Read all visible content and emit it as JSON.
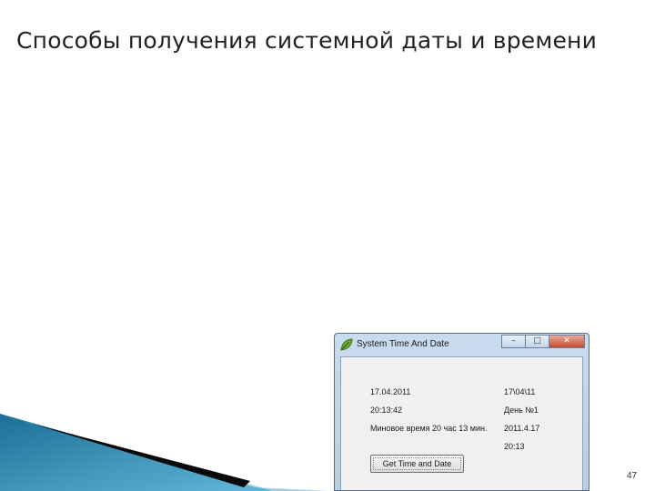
{
  "slide": {
    "title": "Способы получения системной даты и времени",
    "page_number": "47"
  },
  "window": {
    "title": "System Time And Date",
    "controls": {
      "minimize": "–",
      "maximize": "□",
      "close": "✕"
    },
    "left_labels": [
      "17.04.2011",
      "20:13:42",
      "Миновое время 20 час 13 мин."
    ],
    "right_labels": [
      "17\\04\\11",
      "День №1",
      "2011.4.17",
      "20:13"
    ],
    "button_label": "Get Time and Date"
  },
  "colors": {
    "decor_teal": "#1f7fa8",
    "decor_dark": "#0a0a0a",
    "titlebar": "#c9dcef",
    "client": "#f0f0f0"
  }
}
